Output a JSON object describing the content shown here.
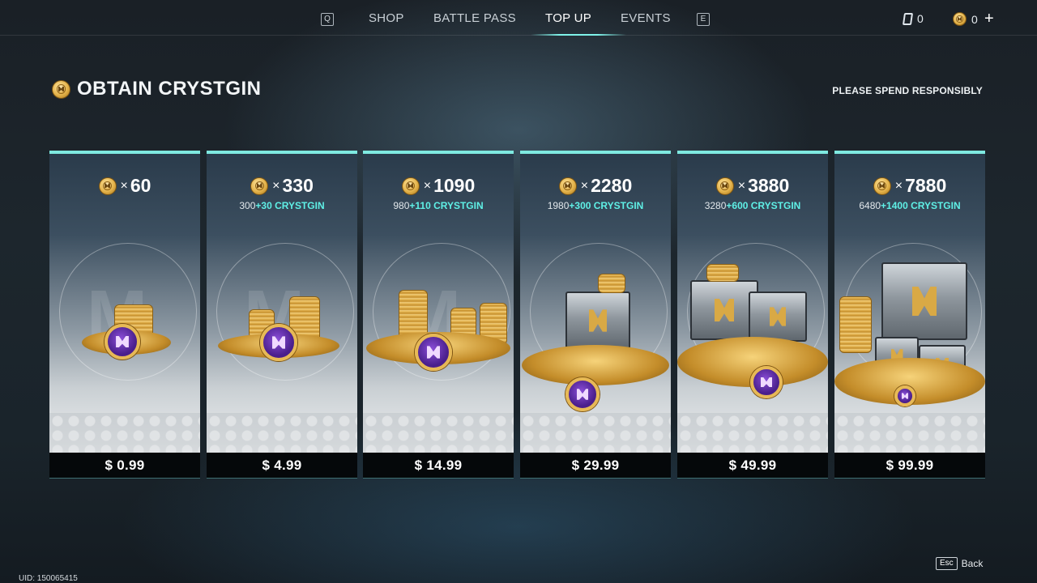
{
  "nav": {
    "prev_key": "Q",
    "next_key": "E",
    "tabs": [
      {
        "label": "SHOP"
      },
      {
        "label": "BATTLE PASS"
      },
      {
        "label": "TOP UP"
      },
      {
        "label": "EVENTS"
      }
    ],
    "active_tab": "TOP UP",
    "currencies": [
      {
        "icon": "pass-card-icon",
        "amount": "0"
      },
      {
        "icon": "crystgin-coin-icon",
        "amount": "0"
      }
    ],
    "add_icon": "plus-icon"
  },
  "header": {
    "title": "OBTAIN CRYSTGIN",
    "notice": "PLEASE SPEND RESPONSIBLY"
  },
  "offers": [
    {
      "amount": "60",
      "base": "",
      "bonus": "",
      "price": "$ 0.99"
    },
    {
      "amount": "330",
      "base": "300",
      "bonus": "+30 CRYSTGIN",
      "price": "$ 4.99"
    },
    {
      "amount": "1090",
      "base": "980",
      "bonus": "+110 CRYSTGIN",
      "price": "$ 14.99"
    },
    {
      "amount": "2280",
      "base": "1980",
      "bonus": "+300 CRYSTGIN",
      "price": "$ 29.99"
    },
    {
      "amount": "3880",
      "base": "3280",
      "bonus": "+600 CRYSTGIN",
      "price": "$ 49.99"
    },
    {
      "amount": "7880",
      "base": "6480",
      "bonus": "+1400 CRYSTGIN",
      "price": "$ 99.99"
    }
  ],
  "amount_prefix": "×",
  "footer": {
    "uid": "UID: 150065415",
    "back_key": "Esc",
    "back_label": "Back"
  },
  "colors": {
    "accent": "#7ee9e0",
    "bonus": "#5ff0e6",
    "coin": "#e3b24a",
    "price_bar": "#05080a"
  }
}
